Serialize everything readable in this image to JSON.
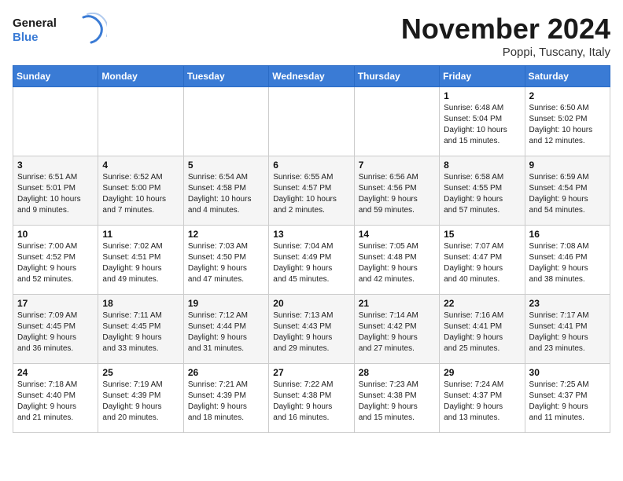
{
  "logo": {
    "line1": "General",
    "line2": "Blue"
  },
  "title": "November 2024",
  "subtitle": "Poppi, Tuscany, Italy",
  "weekdays": [
    "Sunday",
    "Monday",
    "Tuesday",
    "Wednesday",
    "Thursday",
    "Friday",
    "Saturday"
  ],
  "weeks": [
    [
      {
        "day": "",
        "info": ""
      },
      {
        "day": "",
        "info": ""
      },
      {
        "day": "",
        "info": ""
      },
      {
        "day": "",
        "info": ""
      },
      {
        "day": "",
        "info": ""
      },
      {
        "day": "1",
        "info": "Sunrise: 6:48 AM\nSunset: 5:04 PM\nDaylight: 10 hours\nand 15 minutes."
      },
      {
        "day": "2",
        "info": "Sunrise: 6:50 AM\nSunset: 5:02 PM\nDaylight: 10 hours\nand 12 minutes."
      }
    ],
    [
      {
        "day": "3",
        "info": "Sunrise: 6:51 AM\nSunset: 5:01 PM\nDaylight: 10 hours\nand 9 minutes."
      },
      {
        "day": "4",
        "info": "Sunrise: 6:52 AM\nSunset: 5:00 PM\nDaylight: 10 hours\nand 7 minutes."
      },
      {
        "day": "5",
        "info": "Sunrise: 6:54 AM\nSunset: 4:58 PM\nDaylight: 10 hours\nand 4 minutes."
      },
      {
        "day": "6",
        "info": "Sunrise: 6:55 AM\nSunset: 4:57 PM\nDaylight: 10 hours\nand 2 minutes."
      },
      {
        "day": "7",
        "info": "Sunrise: 6:56 AM\nSunset: 4:56 PM\nDaylight: 9 hours\nand 59 minutes."
      },
      {
        "day": "8",
        "info": "Sunrise: 6:58 AM\nSunset: 4:55 PM\nDaylight: 9 hours\nand 57 minutes."
      },
      {
        "day": "9",
        "info": "Sunrise: 6:59 AM\nSunset: 4:54 PM\nDaylight: 9 hours\nand 54 minutes."
      }
    ],
    [
      {
        "day": "10",
        "info": "Sunrise: 7:00 AM\nSunset: 4:52 PM\nDaylight: 9 hours\nand 52 minutes."
      },
      {
        "day": "11",
        "info": "Sunrise: 7:02 AM\nSunset: 4:51 PM\nDaylight: 9 hours\nand 49 minutes."
      },
      {
        "day": "12",
        "info": "Sunrise: 7:03 AM\nSunset: 4:50 PM\nDaylight: 9 hours\nand 47 minutes."
      },
      {
        "day": "13",
        "info": "Sunrise: 7:04 AM\nSunset: 4:49 PM\nDaylight: 9 hours\nand 45 minutes."
      },
      {
        "day": "14",
        "info": "Sunrise: 7:05 AM\nSunset: 4:48 PM\nDaylight: 9 hours\nand 42 minutes."
      },
      {
        "day": "15",
        "info": "Sunrise: 7:07 AM\nSunset: 4:47 PM\nDaylight: 9 hours\nand 40 minutes."
      },
      {
        "day": "16",
        "info": "Sunrise: 7:08 AM\nSunset: 4:46 PM\nDaylight: 9 hours\nand 38 minutes."
      }
    ],
    [
      {
        "day": "17",
        "info": "Sunrise: 7:09 AM\nSunset: 4:45 PM\nDaylight: 9 hours\nand 36 minutes."
      },
      {
        "day": "18",
        "info": "Sunrise: 7:11 AM\nSunset: 4:45 PM\nDaylight: 9 hours\nand 33 minutes."
      },
      {
        "day": "19",
        "info": "Sunrise: 7:12 AM\nSunset: 4:44 PM\nDaylight: 9 hours\nand 31 minutes."
      },
      {
        "day": "20",
        "info": "Sunrise: 7:13 AM\nSunset: 4:43 PM\nDaylight: 9 hours\nand 29 minutes."
      },
      {
        "day": "21",
        "info": "Sunrise: 7:14 AM\nSunset: 4:42 PM\nDaylight: 9 hours\nand 27 minutes."
      },
      {
        "day": "22",
        "info": "Sunrise: 7:16 AM\nSunset: 4:41 PM\nDaylight: 9 hours\nand 25 minutes."
      },
      {
        "day": "23",
        "info": "Sunrise: 7:17 AM\nSunset: 4:41 PM\nDaylight: 9 hours\nand 23 minutes."
      }
    ],
    [
      {
        "day": "24",
        "info": "Sunrise: 7:18 AM\nSunset: 4:40 PM\nDaylight: 9 hours\nand 21 minutes."
      },
      {
        "day": "25",
        "info": "Sunrise: 7:19 AM\nSunset: 4:39 PM\nDaylight: 9 hours\nand 20 minutes."
      },
      {
        "day": "26",
        "info": "Sunrise: 7:21 AM\nSunset: 4:39 PM\nDaylight: 9 hours\nand 18 minutes."
      },
      {
        "day": "27",
        "info": "Sunrise: 7:22 AM\nSunset: 4:38 PM\nDaylight: 9 hours\nand 16 minutes."
      },
      {
        "day": "28",
        "info": "Sunrise: 7:23 AM\nSunset: 4:38 PM\nDaylight: 9 hours\nand 15 minutes."
      },
      {
        "day": "29",
        "info": "Sunrise: 7:24 AM\nSunset: 4:37 PM\nDaylight: 9 hours\nand 13 minutes."
      },
      {
        "day": "30",
        "info": "Sunrise: 7:25 AM\nSunset: 4:37 PM\nDaylight: 9 hours\nand 11 minutes."
      }
    ]
  ]
}
